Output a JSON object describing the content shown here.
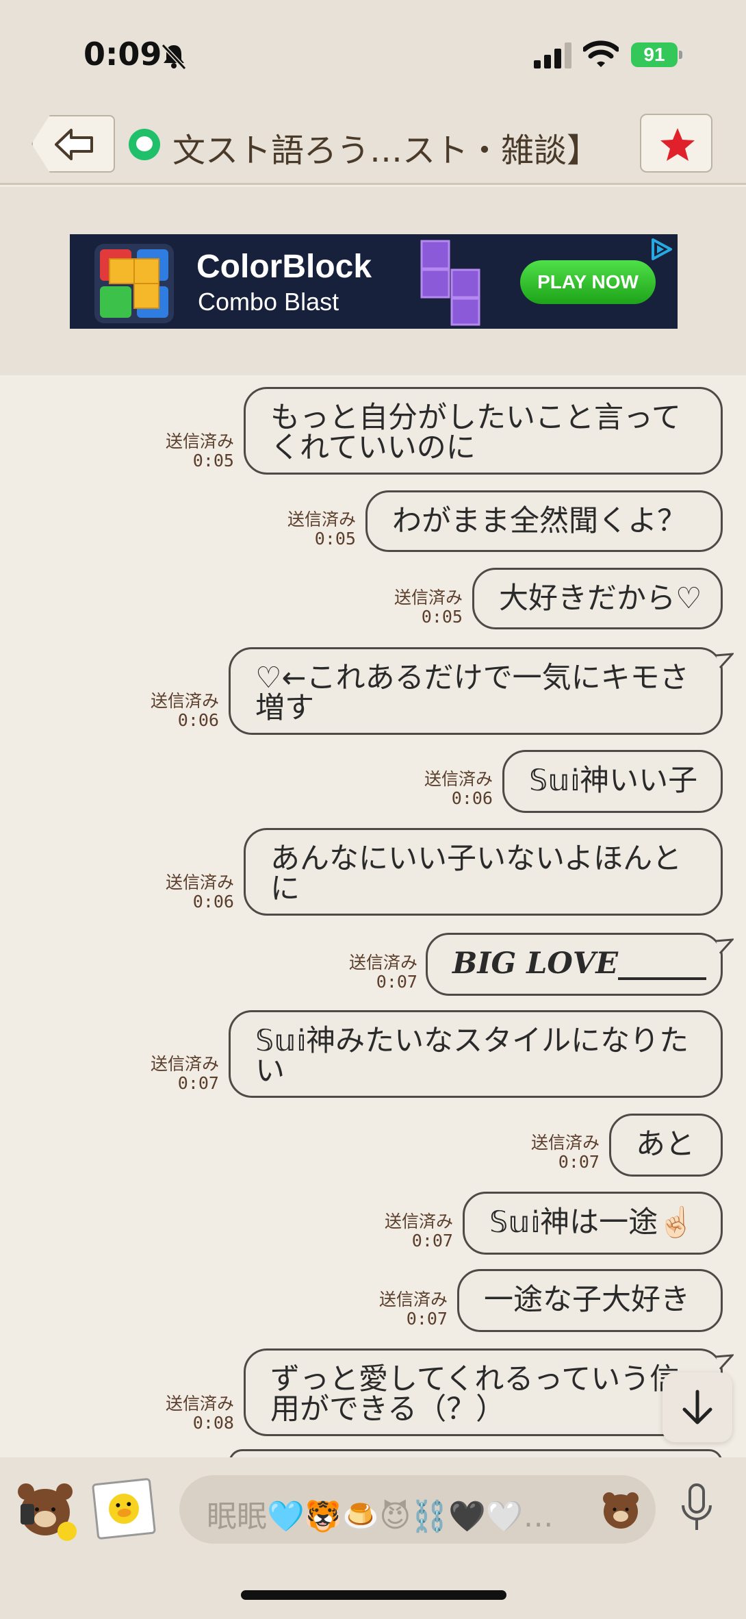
{
  "status_bar": {
    "time": "0:09",
    "battery": "91"
  },
  "header": {
    "title": "文スト語ろう…スト・雑談】"
  },
  "ad": {
    "title": "ColorBlock",
    "subtitle": "Combo Blast",
    "cta": "PLAY NOW"
  },
  "messages": [
    {
      "status": "送信済み",
      "time": "0:05",
      "text": "もっと自分がしたいこと言ってくれていいのに"
    },
    {
      "status": "送信済み",
      "time": "0:05",
      "text": "わがまま全然聞くよ？"
    },
    {
      "status": "送信済み",
      "time": "0:05",
      "text": "大好きだから♡"
    },
    {
      "status": "送信済み",
      "time": "0:06",
      "text": "♡←これあるだけで一気にキモさ増す"
    },
    {
      "status": "送信済み",
      "time": "0:06",
      "text": "𝕊𝕦𝕚神いい子"
    },
    {
      "status": "送信済み",
      "time": "0:06",
      "text": "あんなにいい子いないよほんとに"
    },
    {
      "status": "送信済み",
      "time": "0:07",
      "text": "𝑩𝑰𝑮 𝑳𝑶𝑽𝑬______"
    },
    {
      "status": "送信済み",
      "time": "0:07",
      "text": "𝕊𝕦𝕚神みたいなスタイルになりたい"
    },
    {
      "status": "送信済み",
      "time": "0:07",
      "text": "あと"
    },
    {
      "status": "送信済み",
      "time": "0:07",
      "text": "𝕊𝕦𝕚神は一途☝🏻"
    },
    {
      "status": "送信済み",
      "time": "0:07",
      "text": "一途な子大好き"
    },
    {
      "status": "送信済み",
      "time": "0:08",
      "text": "ずっと愛してくれるっていう信用ができる（？）"
    }
  ],
  "input": {
    "text": "眠眠🩵🐯🍮😈⛓️🖤🤍…"
  },
  "colors": {
    "background": "#f1ece4",
    "header": "#e8e1d7",
    "bubble_border": "#4e4a45",
    "meta_text": "#5a3e2b",
    "favorite_star": "#e0202a",
    "room_icon": "#20c06a",
    "battery": "#34c759"
  }
}
